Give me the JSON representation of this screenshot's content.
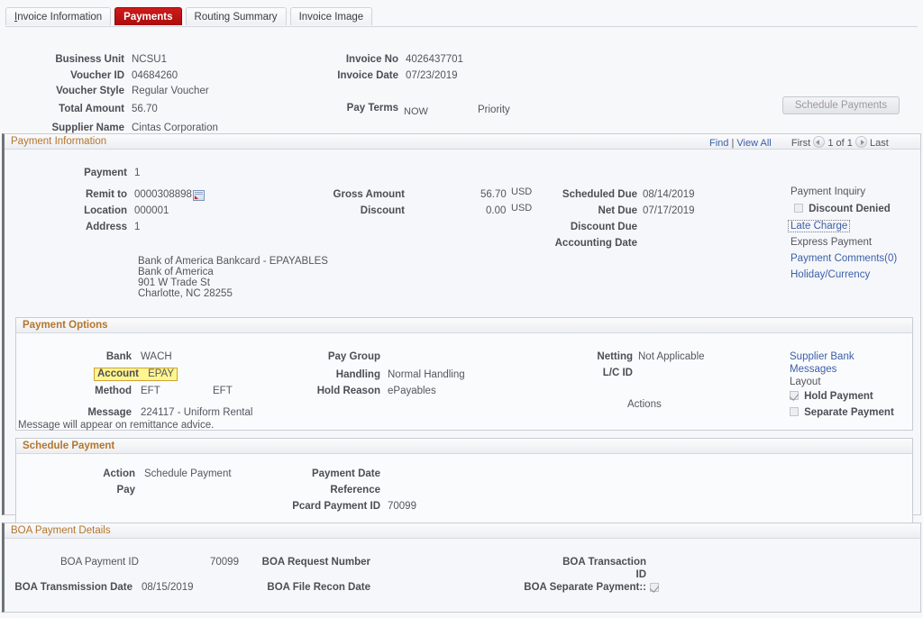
{
  "tabs": [
    {
      "label": "Invoice Information",
      "accel": "I",
      "active": false
    },
    {
      "label": "Payments",
      "accel": "",
      "active": true
    },
    {
      "label": "Routing Summary",
      "accel": "",
      "active": false
    },
    {
      "label": "Invoice Image",
      "accel": "",
      "active": false
    }
  ],
  "header": {
    "business_unit_label": "Business Unit",
    "business_unit_value": "NCSU1",
    "voucher_id_label": "Voucher ID",
    "voucher_id_value": "04684260",
    "voucher_style_label": "Voucher Style",
    "voucher_style_value": "Regular Voucher",
    "total_amount_label": "Total Amount",
    "total_amount_value": "56.70",
    "supplier_name_label": "Supplier Name",
    "supplier_name_value": "Cintas Corporation",
    "invoice_no_label": "Invoice No",
    "invoice_no_value": "4026437701",
    "invoice_date_label": "Invoice Date",
    "invoice_date_value": "07/23/2019",
    "pay_terms_label": "Pay Terms",
    "pay_terms_value": "NOW",
    "priority_label": "Priority",
    "schedule_payments_button": "Schedule Payments"
  },
  "payment_information": {
    "title": "Payment Information",
    "nav": {
      "find": "Find",
      "separator": "|",
      "view_all": "View All",
      "first": "First",
      "counter": "1 of 1",
      "last": "Last"
    },
    "payment_label": "Payment",
    "payment_value": "1",
    "remit_to_label": "Remit to",
    "remit_to_value": "0000308898",
    "location_label": "Location",
    "location_value": "000001",
    "address_label": "Address",
    "address_value": "1",
    "gross_amount_label": "Gross Amount",
    "gross_amount_value": "56.70",
    "gross_amount_currency": "USD",
    "discount_label": "Discount",
    "discount_value": "0.00",
    "discount_currency": "USD",
    "scheduled_due_label": "Scheduled Due",
    "scheduled_due_value": "08/14/2019",
    "net_due_label": "Net Due",
    "net_due_value": "07/17/2019",
    "discount_due_label": "Discount Due",
    "discount_due_value": "",
    "accounting_date_label": "Accounting Date",
    "accounting_date_value": "",
    "payment_inquiry_link": "Payment Inquiry",
    "discount_denied_label": "Discount Denied",
    "discount_denied_checked": false,
    "late_charge_link": "Late Charge",
    "express_payment_link": "Express Payment",
    "payment_comments_link": "Payment Comments(0)",
    "holiday_currency_link": "Holiday/Currency",
    "address_block": [
      "Bank of America Bankcard - EPAYABLES",
      "Bank of America",
      "901 W Trade St",
      "Charlotte, NC  28255"
    ]
  },
  "payment_options": {
    "title": "Payment Options",
    "bank_label": "Bank",
    "bank_value": "WACH",
    "account_label": "Account",
    "account_value": "EPAY",
    "method_label": "Method",
    "method_value": "EFT",
    "method_value2": "EFT",
    "message_label": "Message",
    "message_value": "224117 - Uniform Rental",
    "message_note": "Message will appear on remittance advice.",
    "pay_group_label": "Pay Group",
    "pay_group_value": "",
    "handling_label": "Handling",
    "handling_value": "Normal Handling",
    "hold_reason_label": "Hold Reason",
    "hold_reason_value": "ePayables",
    "netting_label": "Netting",
    "netting_value": "Not Applicable",
    "lc_id_label": "L/C ID",
    "lc_id_value": "",
    "actions_label": "Actions",
    "supplier_bank_link": "Supplier Bank",
    "messages_link": "Messages",
    "layout_label": "Layout",
    "hold_payment_label": "Hold Payment",
    "hold_payment_checked": true,
    "separate_payment_label": "Separate Payment",
    "separate_payment_checked": false
  },
  "schedule_payment": {
    "title": "Schedule Payment",
    "action_label": "Action",
    "action_value": "Schedule Payment",
    "pay_label": "Pay",
    "pay_value": "",
    "payment_date_label": "Payment Date",
    "payment_date_value": "",
    "reference_label": "Reference",
    "reference_value": "",
    "pcard_payment_id_label": "Pcard Payment ID",
    "pcard_payment_id_value": "70099"
  },
  "boa_payment_details": {
    "title": "BOA Payment Details",
    "boa_payment_id_label": "BOA Payment ID",
    "boa_payment_id_value": "70099",
    "boa_transmission_date_label": "BOA Transmission Date",
    "boa_transmission_date_value": "08/15/2019",
    "boa_request_number_label": "BOA Request Number",
    "boa_request_number_value": "",
    "boa_file_recon_date_label": "BOA File Recon Date",
    "boa_file_recon_date_value": "",
    "boa_transaction_id_label_line1": "BOA Transaction",
    "boa_transaction_id_label_line2": "ID",
    "boa_transaction_id_value": "",
    "boa_separate_payment_label": "BOA Separate Payment::",
    "boa_separate_payment_checked": true
  },
  "colors": {
    "accent_tab": "#bf1515",
    "section_header_text": "#b5752b",
    "link": "#3b5fa8",
    "highlight_bg": "#fff68f"
  }
}
